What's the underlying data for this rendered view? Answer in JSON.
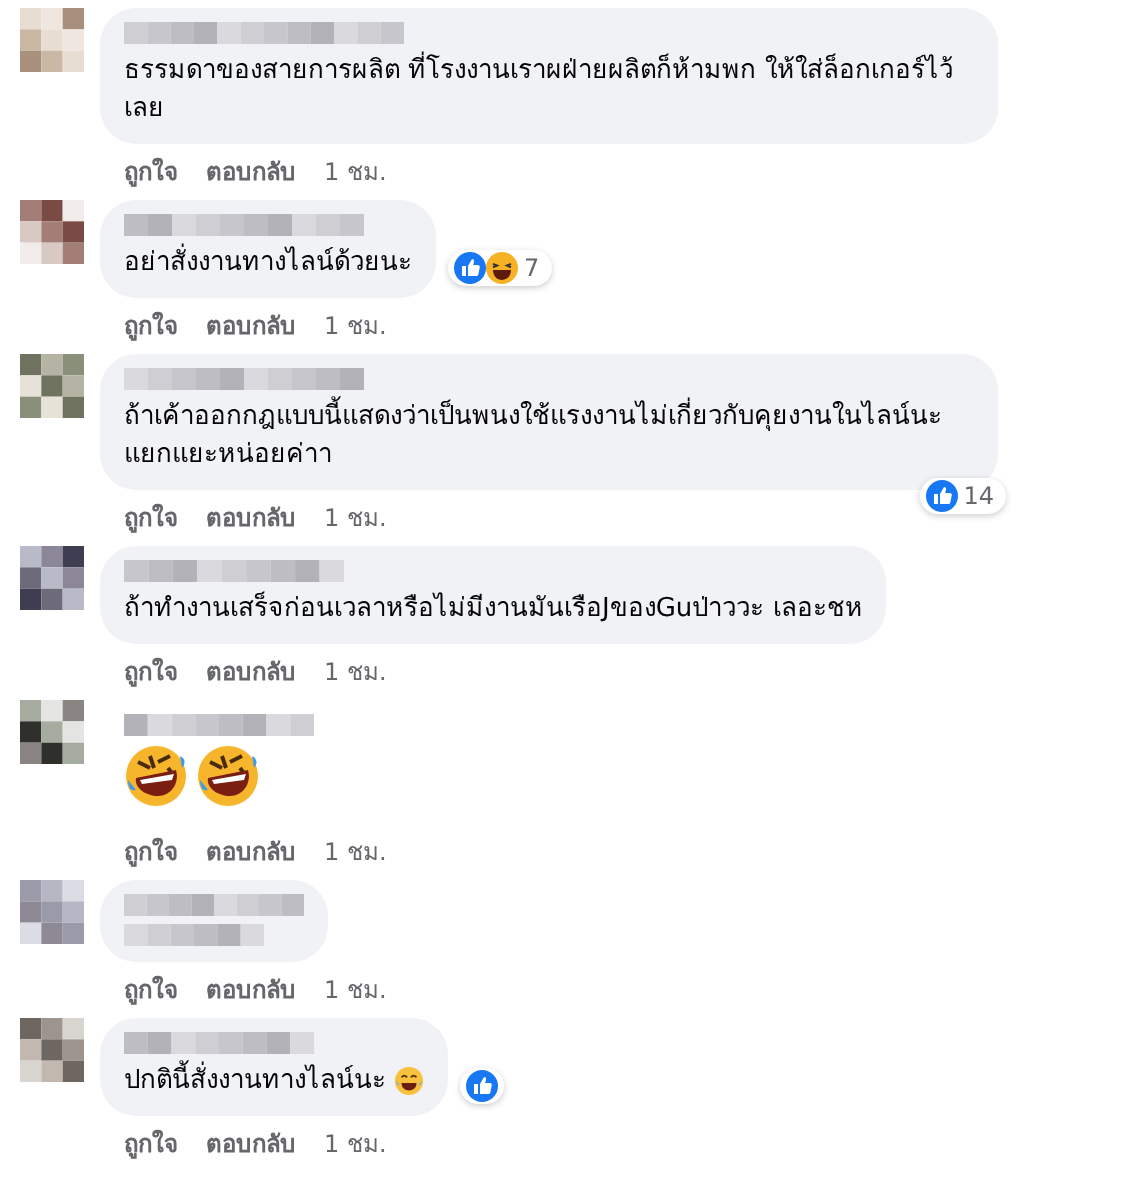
{
  "comments": [
    {
      "text": "ธรรมดาของสายการผลิต ที่โรงงานเราผฝ่ายผลิตก็ห้ามพก ให้ใส่ล็อกเกอร์ไว้เลย",
      "actions": [
        "ถูกใจ",
        "ตอบกลับ",
        "1 ชม."
      ]
    },
    {
      "text": "อย่าสั่งงานทางไลน์ด้วยนะ",
      "reactions": {
        "kind": "inline",
        "icons": [
          {
            "kind": "like"
          },
          {
            "kind": "haha"
          }
        ],
        "count": "7"
      },
      "actions": [
        "ถูกใจ",
        "ตอบกลับ",
        "1 ชม."
      ]
    },
    {
      "text": "ถ้าเค้าออกกฎแบบนี้แสดงว่าเป็นพนงใช้แรงงานไม่เกี่ยวกับคุยงานในไลน์นะ แยกแยะหน่อยค่าา",
      "reactions": {
        "kind": "corner",
        "icons": [
          {
            "kind": "like"
          }
        ],
        "count": "14"
      },
      "actions": [
        "ถูกใจ",
        "ตอบกลับ",
        "1 ชม."
      ]
    },
    {
      "text": "ถ้าทำงานเสร็จก่อนเวลาหรือไม่มีงานมันเรือJของGuป่าววะ เลอะชห",
      "actions": [
        "ถูกใจ",
        "ตอบกลับ",
        "1 ชม."
      ]
    },
    {
      "stickers": [
        {
          "kind": "rofl"
        },
        {
          "kind": "rofl"
        }
      ],
      "actions": [
        "ถูกใจ",
        "ตอบกลับ",
        "1 ชม."
      ]
    },
    {
      "actions": [
        "ถูกใจ",
        "ตอบกลับ",
        "1 ชม."
      ]
    },
    {
      "text": "ปกตินี้สั่งงานทางไลน์นะ",
      "trailing_emoji": {
        "kind": "joy"
      },
      "reactions": {
        "kind": "inline",
        "icons": [
          {
            "kind": "like"
          }
        ]
      },
      "actions": [
        "ถูกใจ",
        "ตอบกลับ",
        "1 ชม."
      ]
    }
  ]
}
